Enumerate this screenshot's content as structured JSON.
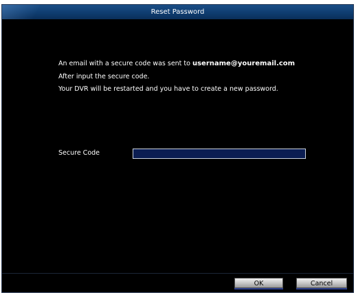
{
  "dialog": {
    "title": "Reset Password"
  },
  "message": {
    "line1_prefix": "An email with a secure code was sent to ",
    "line1_email": "username@youremail.com",
    "line2": "After input the secure code.",
    "line3": "Your DVR will be restarted and you have to create a new password."
  },
  "secure_code": {
    "label": "Secure Code",
    "value": "",
    "placeholder": ""
  },
  "footer": {
    "ok_label": "OK",
    "cancel_label": "Cancel"
  },
  "colors": {
    "titlebar": "#0f3d70",
    "background": "#000000",
    "input_fill": "#0b1d52"
  }
}
